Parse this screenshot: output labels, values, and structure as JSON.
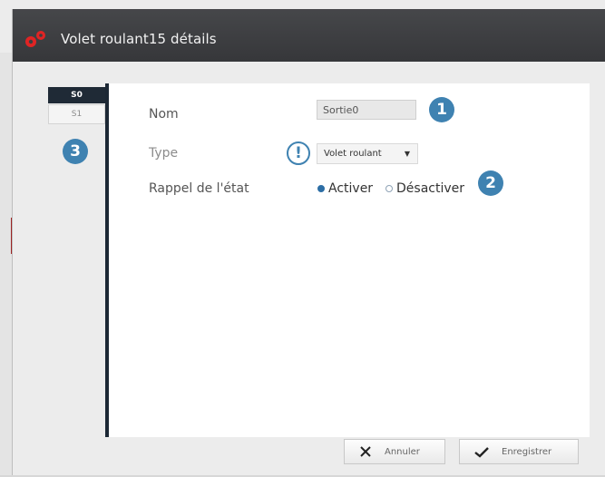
{
  "window": {
    "title": "Volet roulant15 détails"
  },
  "sidebar": {
    "tabs": [
      {
        "label": "S0",
        "active": true
      },
      {
        "label": "S1",
        "active": false
      }
    ]
  },
  "form": {
    "name_label": "Nom",
    "name_value": "Sortie0",
    "type_label": "Type",
    "type_value": "Volet roulant",
    "state_label": "Rappel de l'état",
    "state_options": [
      "Activer",
      "Désactiver"
    ],
    "state_selected": "Activer"
  },
  "callouts": {
    "badge_1": "1",
    "badge_2": "2",
    "badge_3": "3",
    "alert": "!"
  },
  "footer": {
    "cancel_label": "Annuler",
    "save_label": "Enregistrer"
  },
  "colors": {
    "titlebar": "#3d3e41",
    "accent": "#3f82b1",
    "sidebar_active": "#1f2a36"
  },
  "icons": [
    "gears-icon",
    "chevron-down-icon",
    "close-icon",
    "check-icon"
  ]
}
